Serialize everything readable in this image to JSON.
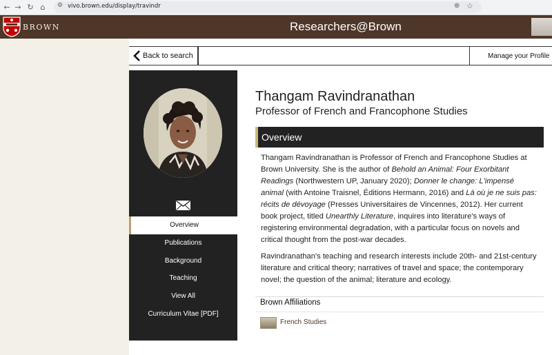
{
  "browser": {
    "url": "vivo.brown.edu/display/travindr"
  },
  "header": {
    "logo_text": "BROWN",
    "site_title": "Researchers@Brown"
  },
  "nav": {
    "back_label": "Back to search",
    "manage_label": "Manage your Profile"
  },
  "profile": {
    "name": "Thangam Ravindranathan",
    "title": "Professor of French and Francophone Studies"
  },
  "sidebar": {
    "items": [
      {
        "label": "Overview",
        "active": true
      },
      {
        "label": "Publications",
        "active": false
      },
      {
        "label": "Background",
        "active": false
      },
      {
        "label": "Teaching",
        "active": false
      },
      {
        "label": "View All",
        "active": false
      },
      {
        "label": "Curriculum Vitae [PDF]",
        "active": false
      }
    ]
  },
  "overview": {
    "heading": "Overview",
    "p1": {
      "t1": "Thangam Ravindranathan is Professor of French and Francophone Studies at Brown University. She is the author of ",
      "i1": "Behold an Animal: Four Exorbitant Readings",
      "t2": " (Northwestern UP, January 2020); ",
      "i2": "Donner le change: L'impensé animal",
      "t3": " (with Antoine Traisnel, Éditions Hermann, 2016) and ",
      "i3": "Là où je ne suis pas: récits de dévoyage",
      "t4": " (Presses Universitaires de Vincennes, 2012). Her current book project, titled ",
      "i4": "Unearthly Literature",
      "t5": ", inquires into literature's ways of registering environmental degradation, with a particular focus on novels and critical thought from the post-war decades."
    },
    "p2": "Ravindranathan's teaching and research interests include 20th- and 21st-century literature and critical theory; narratives of travel and space; the contemporary novel; the question of the animal; literature and ecology."
  },
  "affiliations": {
    "heading": "Brown Affiliations",
    "items": [
      {
        "label": "French Studies"
      }
    ]
  },
  "colors": {
    "brand_brown": "#4e3629",
    "accent_gold": "#c8b978",
    "sidebar_bg": "#222222",
    "page_cream": "#f3f0e8"
  },
  "icons": {
    "logo": "brown-shield-icon",
    "back": "chevron-left-icon",
    "email": "envelope-icon",
    "zoom": "zoom-icon",
    "bookmark": "star-icon"
  }
}
